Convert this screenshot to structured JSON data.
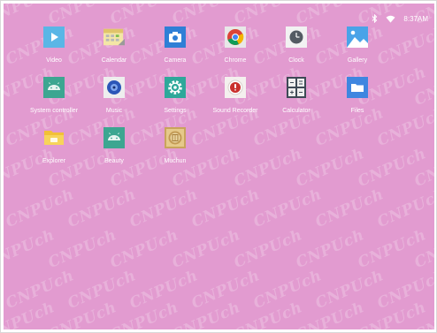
{
  "status_bar": {
    "bluetooth_icon": "bluetooth-icon",
    "wifi_icon": "wifi-icon",
    "time": "8:37AM"
  },
  "apps": [
    {
      "label": "Video",
      "icon": "video-icon"
    },
    {
      "label": "Calendar",
      "icon": "calendar-icon"
    },
    {
      "label": "Camera",
      "icon": "camera-icon"
    },
    {
      "label": "Chrome",
      "icon": "chrome-icon"
    },
    {
      "label": "Clock",
      "icon": "clock-icon"
    },
    {
      "label": "Gallery",
      "icon": "gallery-icon"
    },
    {
      "label": "System controller",
      "icon": "android-icon"
    },
    {
      "label": "Music",
      "icon": "music-icon"
    },
    {
      "label": "Settings",
      "icon": "gear-icon"
    },
    {
      "label": "Sound Recorder",
      "icon": "sound-recorder-icon"
    },
    {
      "label": "Calculator",
      "icon": "calculator-icon"
    },
    {
      "label": "Files",
      "icon": "folder-icon"
    },
    {
      "label": "Explorer",
      "icon": "explorer-folder-icon"
    },
    {
      "label": "Beauty",
      "icon": "android-icon"
    },
    {
      "label": "Muchun",
      "icon": "muchun-icon"
    }
  ],
  "watermark": {
    "text": "CNPUch"
  },
  "colors": {
    "wallpaper": "#e29bd0",
    "video_tile": "#5ab6e6",
    "camera_tile": "#2f7fd6",
    "android_tile": "#3da691",
    "settings_tile": "#2ea89a",
    "files_tile": "#3f86e0"
  }
}
